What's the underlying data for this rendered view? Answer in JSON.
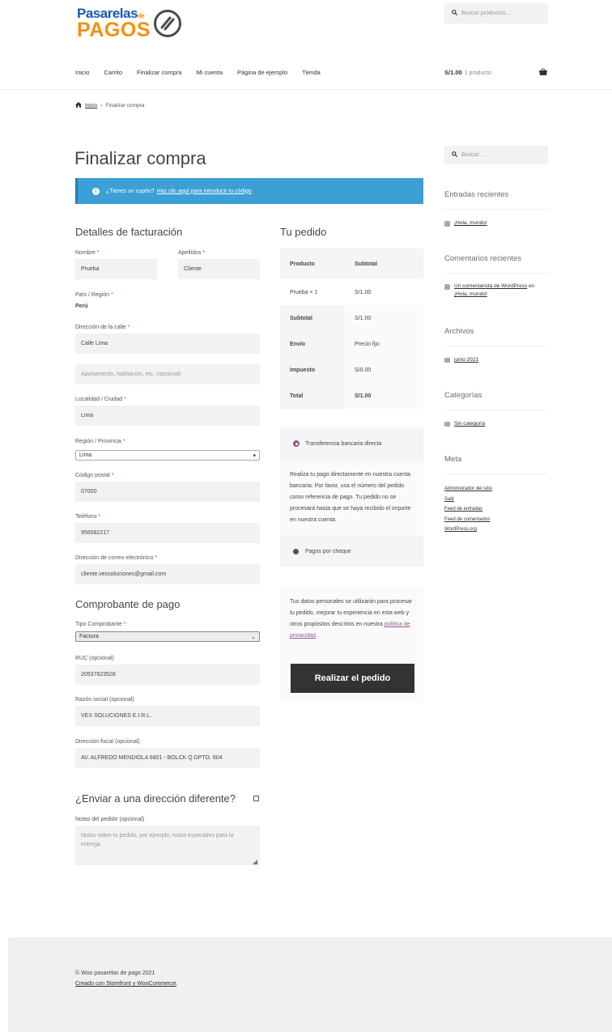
{
  "header": {
    "logo": {
      "top": "Pasarelas",
      "small": "de",
      "bottom": "PAGOS"
    },
    "search_placeholder": "Buscar productos…",
    "nav": [
      "Inicio",
      "Carrito",
      "Finalizar compra",
      "Mi cuenta",
      "Página de ejemplo",
      "Tienda"
    ],
    "cart_total": "S/1.00",
    "cart_count": "1 producto"
  },
  "breadcrumb": {
    "home": "Inicio",
    "separator": "›",
    "current": "Finalizar compra"
  },
  "page_title": "Finalizar compra",
  "coupon_notice": {
    "text": "¿Tienes un cupón?",
    "link": "Haz clic aquí para introducir tu código"
  },
  "billing": {
    "title": "Detalles de facturación",
    "nombre_label": "Nombre",
    "nombre": "Prueba",
    "apellidos_label": "Apellidos",
    "apellidos": "Cliente",
    "pais_label": "País / Región",
    "pais": "Perú",
    "calle_label": "Dirección de la calle",
    "calle": "Calle Lima",
    "apto_placeholder": "Apartamento, habitación, etc. (opcional)",
    "ciudad_label": "Localidad / Ciudad",
    "ciudad": "Lima",
    "region_label": "Región / Provincia",
    "region": "Lima",
    "postal_label": "Código postal",
    "postal": "07000",
    "telefono_label": "Teléfono",
    "telefono": "956582217",
    "email_label": "Dirección de correo electrónico",
    "email": "cliente.vexsoluciones@gmail.com"
  },
  "comprobante": {
    "title": "Comprobante de pago",
    "tipo_label": "Tipo Comprobante",
    "tipo": "Factura",
    "ruc_label": "RUC (opcional)",
    "ruc": "20537623528",
    "razon_label": "Razón social (opcional)",
    "razon": "VEX SOLUCIONES E.I.R.L.",
    "direccion_label": "Dirección fiscal (opcional)",
    "direccion": "AV. ALFREDO MENDIOLA 6801 - BOLCK Q DPTO. 604"
  },
  "shipping": {
    "title": "¿Enviar a una dirección diferente?",
    "notes_label": "Notas del pedido (opcional)",
    "notes_placeholder": "Notas sobre tu pedido, por ejemplo, notas especiales para la entrega."
  },
  "order": {
    "title": "Tu pedido",
    "head": [
      "Producto",
      "Subtotal"
    ],
    "rows": [
      [
        "Prueba × 1",
        "S/1.00"
      ],
      [
        "Subtotal",
        "S/1.00"
      ],
      [
        "Envío",
        "Precio fijo"
      ],
      [
        "Impuesto",
        "S/0.00"
      ],
      [
        "Total",
        "S/1.00"
      ]
    ]
  },
  "payment": {
    "method1": "Transferencia bancaria directa",
    "description": "Realiza tu pago directamente en nuestra cuenta bancaria. Por favor, usa el número del pedido como referencia de pago. Tu pedido no se procesará hasta que se haya recibido el importe en nuestra cuenta.",
    "method2": "Pagos por cheque",
    "privacy_text": "Tus datos personales se utilizarán para procesar tu pedido, mejorar tu experiencia en esta web y otros propósitos descritos en nuestra",
    "privacy_link": "política de privacidad",
    "privacy_end": ".",
    "button": "Realizar el pedido"
  },
  "sidebar": {
    "search_placeholder": "Buscar …",
    "recent_posts_title": "Entradas recientes",
    "recent_post": "¡Hola, mundo!",
    "recent_comments_title": "Comentarios recientes",
    "comment_author": "Un comentarista de WordPress",
    "comment_on": "en",
    "comment_post": "¡Hola, mundo!",
    "archives_title": "Archivos",
    "archive": "junio 2021",
    "categories_title": "Categorías",
    "category": "Sin categoría",
    "meta_title": "Meta",
    "meta": [
      "Administrador del sitio",
      "Salir",
      "Feed de entradas",
      "Feed de comentarios",
      "WordPress.org"
    ]
  },
  "footer": {
    "copyright": "© Woo pasarelas de pago 2021",
    "credit": "Creado con Storefront y WooCommerce",
    "credit_end": "."
  },
  "colors": {
    "notice": "#3c9fd6",
    "required": "#e2401c",
    "accent": "#96588a",
    "logo_blue": "#1b56b8",
    "logo_orange": "#f29111"
  }
}
